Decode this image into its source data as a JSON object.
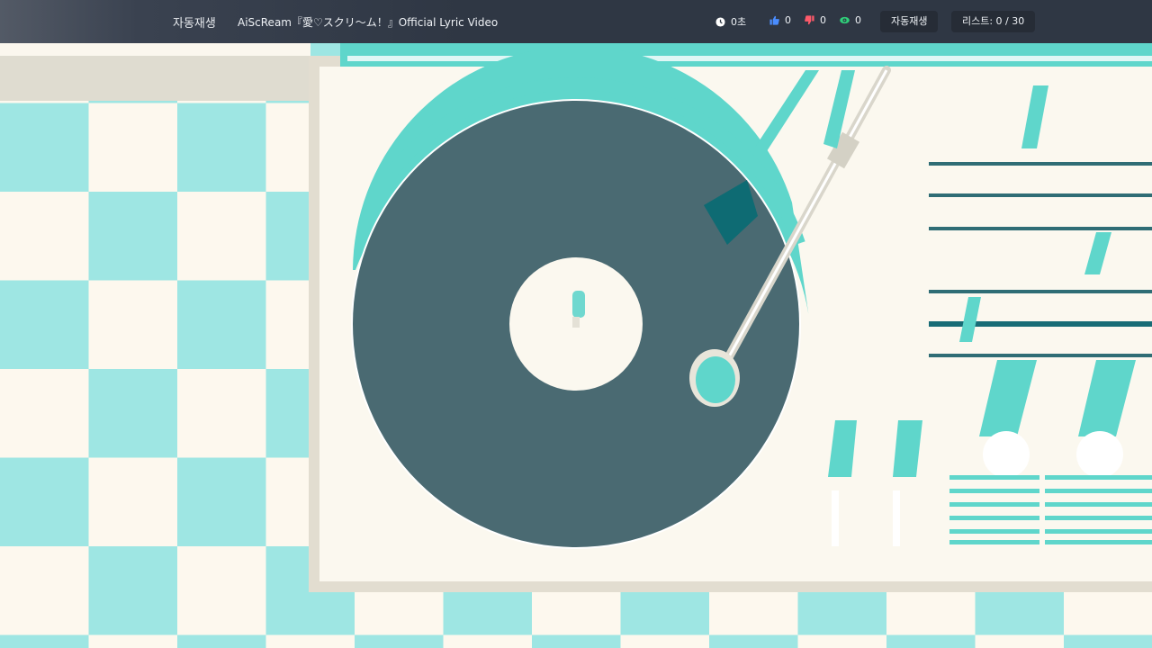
{
  "header": {
    "autoplay_label": "자동재생",
    "video_title": "AiScReam『愛♡スクリ～ム！』Official Lyric Video",
    "time_value": "0초",
    "likes": "0",
    "dislikes": "0",
    "views": "0",
    "autoplay_button": "자동재생",
    "list_button": "리스트: 0 / 30"
  },
  "colors": {
    "teal": "#5fd6cb",
    "checker_teal": "#9ee6e3",
    "record": "#4a6a72",
    "cream": "#fdf8ee",
    "topbar": "#2f3744"
  },
  "icons": {
    "clock": "clock-icon",
    "like": "thumbs-up-icon",
    "dislike": "thumbs-down-icon",
    "views": "eye-icon"
  }
}
